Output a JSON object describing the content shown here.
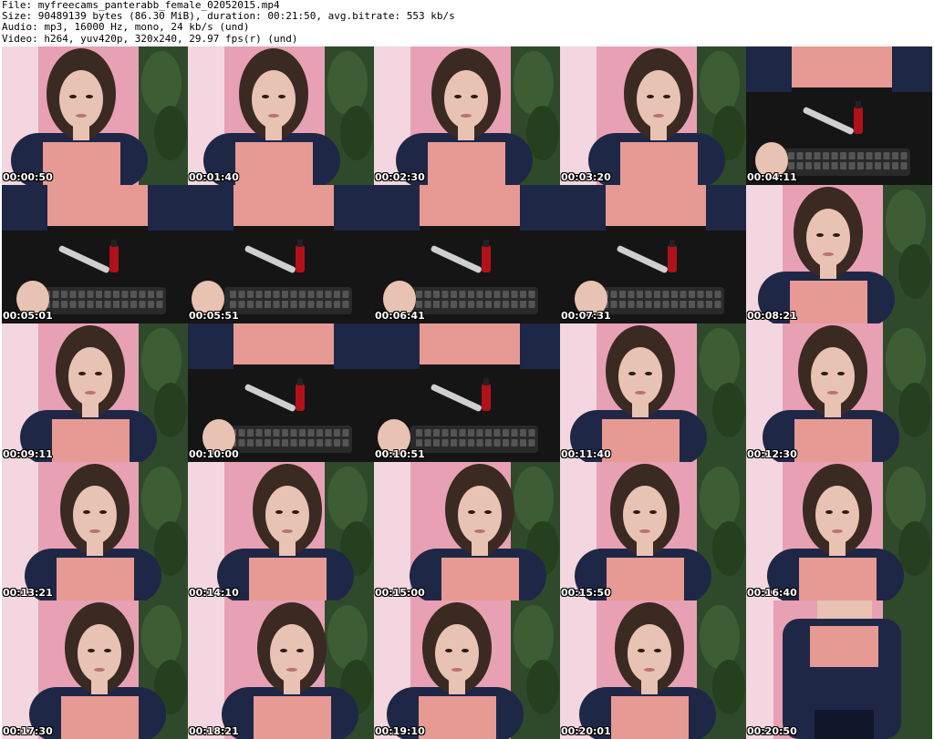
{
  "header": {
    "file_line": "File: myfreecams_panterabb_female_02052015.mp4",
    "size_line": "Size: 90489139 bytes (86.30 MiB), duration: 00:21:50, avg.bitrate: 553 kb/s",
    "audio_line": "Audio: mp3, 16000 Hz, mono, 24 kb/s (und)",
    "video_line": "Video: h264, yuv420p, 320x240, 29.97 fps(r) (und)"
  },
  "thumbnails": [
    {
      "time": "00:00:50",
      "scene": "face"
    },
    {
      "time": "00:01:40",
      "scene": "face"
    },
    {
      "time": "00:02:30",
      "scene": "face"
    },
    {
      "time": "00:03:20",
      "scene": "face"
    },
    {
      "time": "00:04:11",
      "scene": "desk"
    },
    {
      "time": "00:05:01",
      "scene": "desk"
    },
    {
      "time": "00:05:51",
      "scene": "desk"
    },
    {
      "time": "00:06:41",
      "scene": "desk"
    },
    {
      "time": "00:07:31",
      "scene": "desk"
    },
    {
      "time": "00:08:21",
      "scene": "face"
    },
    {
      "time": "00:09:11",
      "scene": "face"
    },
    {
      "time": "00:10:00",
      "scene": "desk"
    },
    {
      "time": "00:10:51",
      "scene": "desk"
    },
    {
      "time": "00:11:40",
      "scene": "face"
    },
    {
      "time": "00:12:30",
      "scene": "face"
    },
    {
      "time": "00:13:21",
      "scene": "face"
    },
    {
      "time": "00:14:10",
      "scene": "face"
    },
    {
      "time": "00:15:00",
      "scene": "face"
    },
    {
      "time": "00:15:50",
      "scene": "face"
    },
    {
      "time": "00:16:40",
      "scene": "face"
    },
    {
      "time": "00:17:30",
      "scene": "face"
    },
    {
      "time": "00:18:21",
      "scene": "face"
    },
    {
      "time": "00:19:10",
      "scene": "face"
    },
    {
      "time": "00:20:01",
      "scene": "face"
    },
    {
      "time": "00:20:50",
      "scene": "standing"
    }
  ],
  "colors": {
    "wall_pink": "#e8a0b4",
    "wall_light": "#f3d6e0",
    "top_navy": "#1f2747",
    "top_pink": "#e69a93",
    "hair": "#3a2a22",
    "skin": "#e8c2b2",
    "plant": "#2f4a2a",
    "desk": "#151515",
    "keyboard": "#2a2a2a"
  }
}
